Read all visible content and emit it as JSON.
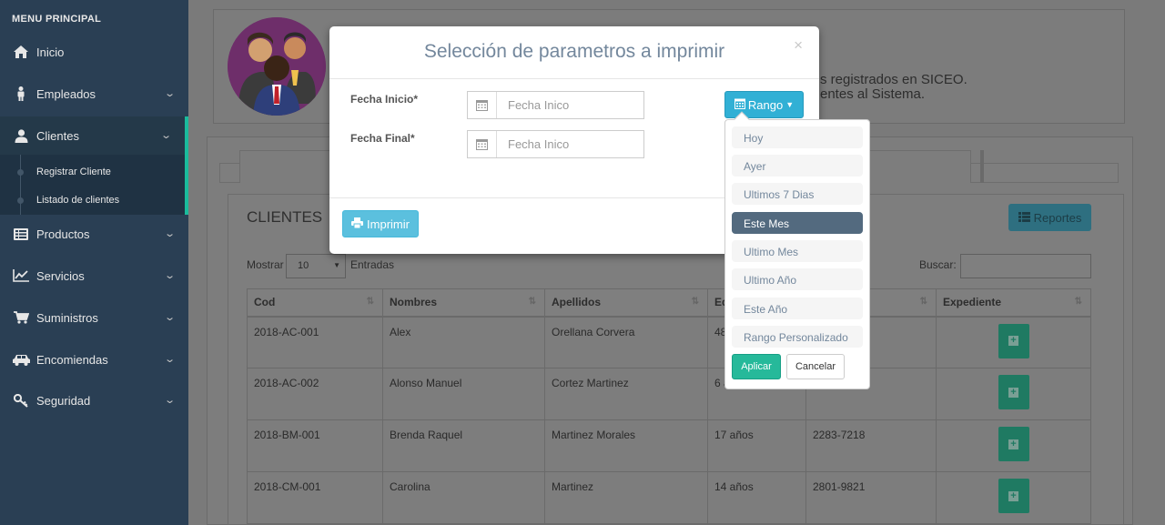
{
  "sidebar": {
    "menu_title": "MENU PRINCIPAL",
    "items": [
      {
        "label": "Inicio",
        "icon": "home-icon"
      },
      {
        "label": "Empleados",
        "icon": "user-icon"
      },
      {
        "label": "Clientes",
        "icon": "users-icon"
      },
      {
        "label": "Productos",
        "icon": "list-icon"
      },
      {
        "label": "Servicios",
        "icon": "chart-icon"
      },
      {
        "label": "Suministros",
        "icon": "cart-icon"
      },
      {
        "label": "Encomiendas",
        "icon": "truck-icon"
      },
      {
        "label": "Seguridad",
        "icon": "key-icon"
      }
    ],
    "submenu": [
      {
        "label": "Registrar Cliente"
      },
      {
        "label": "Listado de clientes"
      }
    ]
  },
  "profile": {
    "line1": "s registrados en SICEO.",
    "line2": "entes al Sistema."
  },
  "clients": {
    "title": "CLIENTES",
    "reportes_label": "Reportes",
    "mostrar_label": "Mostrar",
    "page_length": "10",
    "entradas_label": "Entradas",
    "buscar_label": "Buscar:",
    "columns": [
      "Cod",
      "Nombres",
      "Apellidos",
      "Ed",
      "",
      "Expediente"
    ],
    "rows": [
      {
        "cod": "2018-AC-001",
        "nombres": "Alex",
        "apellidos": "Orellana Corvera",
        "edad": "48",
        "telefono": ""
      },
      {
        "cod": "2018-AC-002",
        "nombres": "Alonso Manuel",
        "apellidos": "Cortez Martinez",
        "edad": "6 a",
        "telefono": ""
      },
      {
        "cod": "2018-BM-001",
        "nombres": "Brenda Raquel",
        "apellidos": "Martinez Morales",
        "edad": "17 años",
        "telefono": "2283-7218"
      },
      {
        "cod": "2018-CM-001",
        "nombres": "Carolina",
        "apellidos": "Martinez",
        "edad": "14 años",
        "telefono": "2801-9821"
      }
    ]
  },
  "modal": {
    "title": "Selección de parametros a imprimir",
    "close": "×",
    "fecha_inicio_label": "Fecha Inicio*",
    "fecha_inicio_placeholder": "Fecha Inico",
    "fecha_final_label": "Fecha Final*",
    "fecha_final_placeholder": "Fecha Inico",
    "rango_label": "Rango",
    "imprimir_label": "Imprimir"
  },
  "range_picker": {
    "options": [
      "Hoy",
      "Ayer",
      "Ultimos 7 Dias",
      "Este Mes",
      "Ultimo Mes",
      "Ultimo Año",
      "Este Año",
      "Rango Personalizado"
    ],
    "selected": "Este Mes",
    "apply_label": "Aplicar",
    "cancel_label": "Cancelar"
  },
  "colors": {
    "sidebar_bg": "#2a3f54",
    "accent_green": "#1abb9c",
    "info_blue": "#5bc0de",
    "range_active": "#536a7f"
  }
}
